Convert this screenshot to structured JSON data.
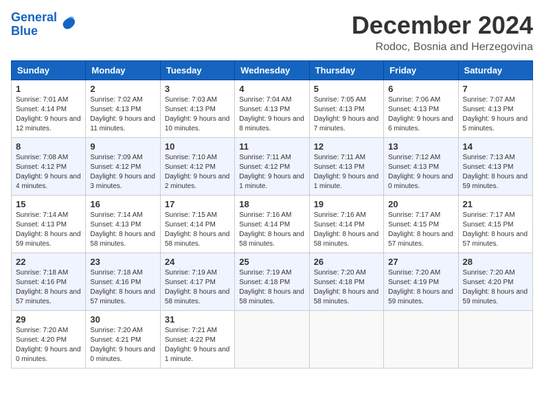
{
  "header": {
    "logo_line1": "General",
    "logo_line2": "Blue",
    "main_title": "December 2024",
    "subtitle": "Rodoc, Bosnia and Herzegovina"
  },
  "calendar": {
    "headers": [
      "Sunday",
      "Monday",
      "Tuesday",
      "Wednesday",
      "Thursday",
      "Friday",
      "Saturday"
    ],
    "weeks": [
      [
        {
          "day": "1",
          "sunrise": "7:01 AM",
          "sunset": "4:14 PM",
          "daylight": "9 hours and 12 minutes."
        },
        {
          "day": "2",
          "sunrise": "7:02 AM",
          "sunset": "4:13 PM",
          "daylight": "9 hours and 11 minutes."
        },
        {
          "day": "3",
          "sunrise": "7:03 AM",
          "sunset": "4:13 PM",
          "daylight": "9 hours and 10 minutes."
        },
        {
          "day": "4",
          "sunrise": "7:04 AM",
          "sunset": "4:13 PM",
          "daylight": "9 hours and 8 minutes."
        },
        {
          "day": "5",
          "sunrise": "7:05 AM",
          "sunset": "4:13 PM",
          "daylight": "9 hours and 7 minutes."
        },
        {
          "day": "6",
          "sunrise": "7:06 AM",
          "sunset": "4:13 PM",
          "daylight": "9 hours and 6 minutes."
        },
        {
          "day": "7",
          "sunrise": "7:07 AM",
          "sunset": "4:13 PM",
          "daylight": "9 hours and 5 minutes."
        }
      ],
      [
        {
          "day": "8",
          "sunrise": "7:08 AM",
          "sunset": "4:12 PM",
          "daylight": "9 hours and 4 minutes."
        },
        {
          "day": "9",
          "sunrise": "7:09 AM",
          "sunset": "4:12 PM",
          "daylight": "9 hours and 3 minutes."
        },
        {
          "day": "10",
          "sunrise": "7:10 AM",
          "sunset": "4:12 PM",
          "daylight": "9 hours and 2 minutes."
        },
        {
          "day": "11",
          "sunrise": "7:11 AM",
          "sunset": "4:12 PM",
          "daylight": "9 hours and 1 minute."
        },
        {
          "day": "12",
          "sunrise": "7:11 AM",
          "sunset": "4:13 PM",
          "daylight": "9 hours and 1 minute."
        },
        {
          "day": "13",
          "sunrise": "7:12 AM",
          "sunset": "4:13 PM",
          "daylight": "9 hours and 0 minutes."
        },
        {
          "day": "14",
          "sunrise": "7:13 AM",
          "sunset": "4:13 PM",
          "daylight": "8 hours and 59 minutes."
        }
      ],
      [
        {
          "day": "15",
          "sunrise": "7:14 AM",
          "sunset": "4:13 PM",
          "daylight": "8 hours and 59 minutes."
        },
        {
          "day": "16",
          "sunrise": "7:14 AM",
          "sunset": "4:13 PM",
          "daylight": "8 hours and 58 minutes."
        },
        {
          "day": "17",
          "sunrise": "7:15 AM",
          "sunset": "4:14 PM",
          "daylight": "8 hours and 58 minutes."
        },
        {
          "day": "18",
          "sunrise": "7:16 AM",
          "sunset": "4:14 PM",
          "daylight": "8 hours and 58 minutes."
        },
        {
          "day": "19",
          "sunrise": "7:16 AM",
          "sunset": "4:14 PM",
          "daylight": "8 hours and 58 minutes."
        },
        {
          "day": "20",
          "sunrise": "7:17 AM",
          "sunset": "4:15 PM",
          "daylight": "8 hours and 57 minutes."
        },
        {
          "day": "21",
          "sunrise": "7:17 AM",
          "sunset": "4:15 PM",
          "daylight": "8 hours and 57 minutes."
        }
      ],
      [
        {
          "day": "22",
          "sunrise": "7:18 AM",
          "sunset": "4:16 PM",
          "daylight": "8 hours and 57 minutes."
        },
        {
          "day": "23",
          "sunrise": "7:18 AM",
          "sunset": "4:16 PM",
          "daylight": "8 hours and 57 minutes."
        },
        {
          "day": "24",
          "sunrise": "7:19 AM",
          "sunset": "4:17 PM",
          "daylight": "8 hours and 58 minutes."
        },
        {
          "day": "25",
          "sunrise": "7:19 AM",
          "sunset": "4:18 PM",
          "daylight": "8 hours and 58 minutes."
        },
        {
          "day": "26",
          "sunrise": "7:20 AM",
          "sunset": "4:18 PM",
          "daylight": "8 hours and 58 minutes."
        },
        {
          "day": "27",
          "sunrise": "7:20 AM",
          "sunset": "4:19 PM",
          "daylight": "8 hours and 59 minutes."
        },
        {
          "day": "28",
          "sunrise": "7:20 AM",
          "sunset": "4:20 PM",
          "daylight": "8 hours and 59 minutes."
        }
      ],
      [
        {
          "day": "29",
          "sunrise": "7:20 AM",
          "sunset": "4:20 PM",
          "daylight": "9 hours and 0 minutes."
        },
        {
          "day": "30",
          "sunrise": "7:20 AM",
          "sunset": "4:21 PM",
          "daylight": "9 hours and 0 minutes."
        },
        {
          "day": "31",
          "sunrise": "7:21 AM",
          "sunset": "4:22 PM",
          "daylight": "9 hours and 1 minute."
        },
        null,
        null,
        null,
        null
      ]
    ]
  }
}
